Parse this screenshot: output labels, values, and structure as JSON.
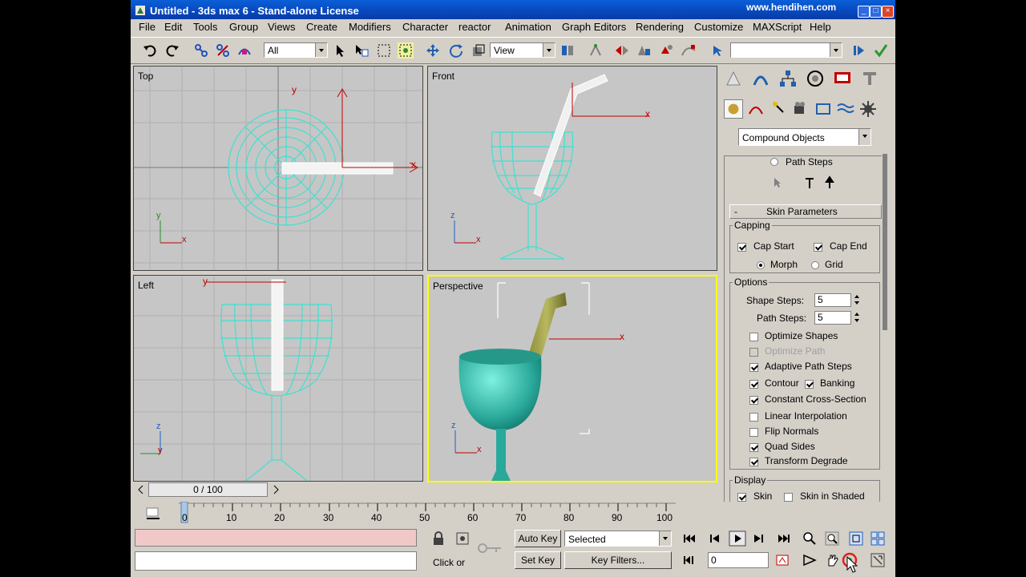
{
  "window": {
    "title": "Untitled - 3ds max 6 - Stand-alone License",
    "watermark": "www.hendihen.com"
  },
  "menu": [
    "File",
    "Edit",
    "Tools",
    "Group",
    "Views",
    "Create",
    "Modifiers",
    "Character",
    "reactor",
    "Animation",
    "Graph Editors",
    "Rendering",
    "Customize",
    "MAXScript",
    "Help"
  ],
  "toolbar": {
    "selection_filter": "All",
    "reference_coord": "View",
    "named_selection": ""
  },
  "viewports": {
    "top": "Top",
    "front": "Front",
    "left": "Left",
    "perspective": "Perspective"
  },
  "axis": {
    "x": "x",
    "y": "y",
    "z": "z"
  },
  "command_panel": {
    "category": "Compound Objects",
    "path_steps_radio": "Path Steps",
    "rollout_toggle": "-",
    "rollout_title": "Skin Parameters",
    "capping": {
      "label": "Capping",
      "cap_start": "Cap Start",
      "cap_end": "Cap End",
      "morph": "Morph",
      "grid": "Grid"
    },
    "options": {
      "label": "Options",
      "shape_steps_label": "Shape Steps:",
      "shape_steps_value": "5",
      "path_steps_label": "Path Steps:",
      "path_steps_value": "5",
      "optimize_shapes": "Optimize Shapes",
      "optimize_path": "Optimize Path",
      "adaptive_path_steps": "Adaptive Path Steps",
      "contour": "Contour",
      "banking": "Banking",
      "constant_cross_section": "Constant Cross-Section",
      "linear_interpolation": "Linear Interpolation",
      "flip_normals": "Flip Normals",
      "quad_sides": "Quad Sides",
      "transform_degrade": "Transform Degrade"
    },
    "display": {
      "label": "Display",
      "skin": "Skin",
      "skin_in_shaded": "Skin in Shaded"
    }
  },
  "time": {
    "slider": "0 / 100",
    "ticks": [
      "0",
      "10",
      "20",
      "30",
      "40",
      "50",
      "60",
      "70",
      "80",
      "90",
      "100"
    ],
    "current_frame": "0"
  },
  "status": {
    "prompt": "Click or",
    "auto_key": "Auto Key",
    "set_key": "Set Key",
    "key_mode": "Selected",
    "key_filters": "Key Filters..."
  }
}
